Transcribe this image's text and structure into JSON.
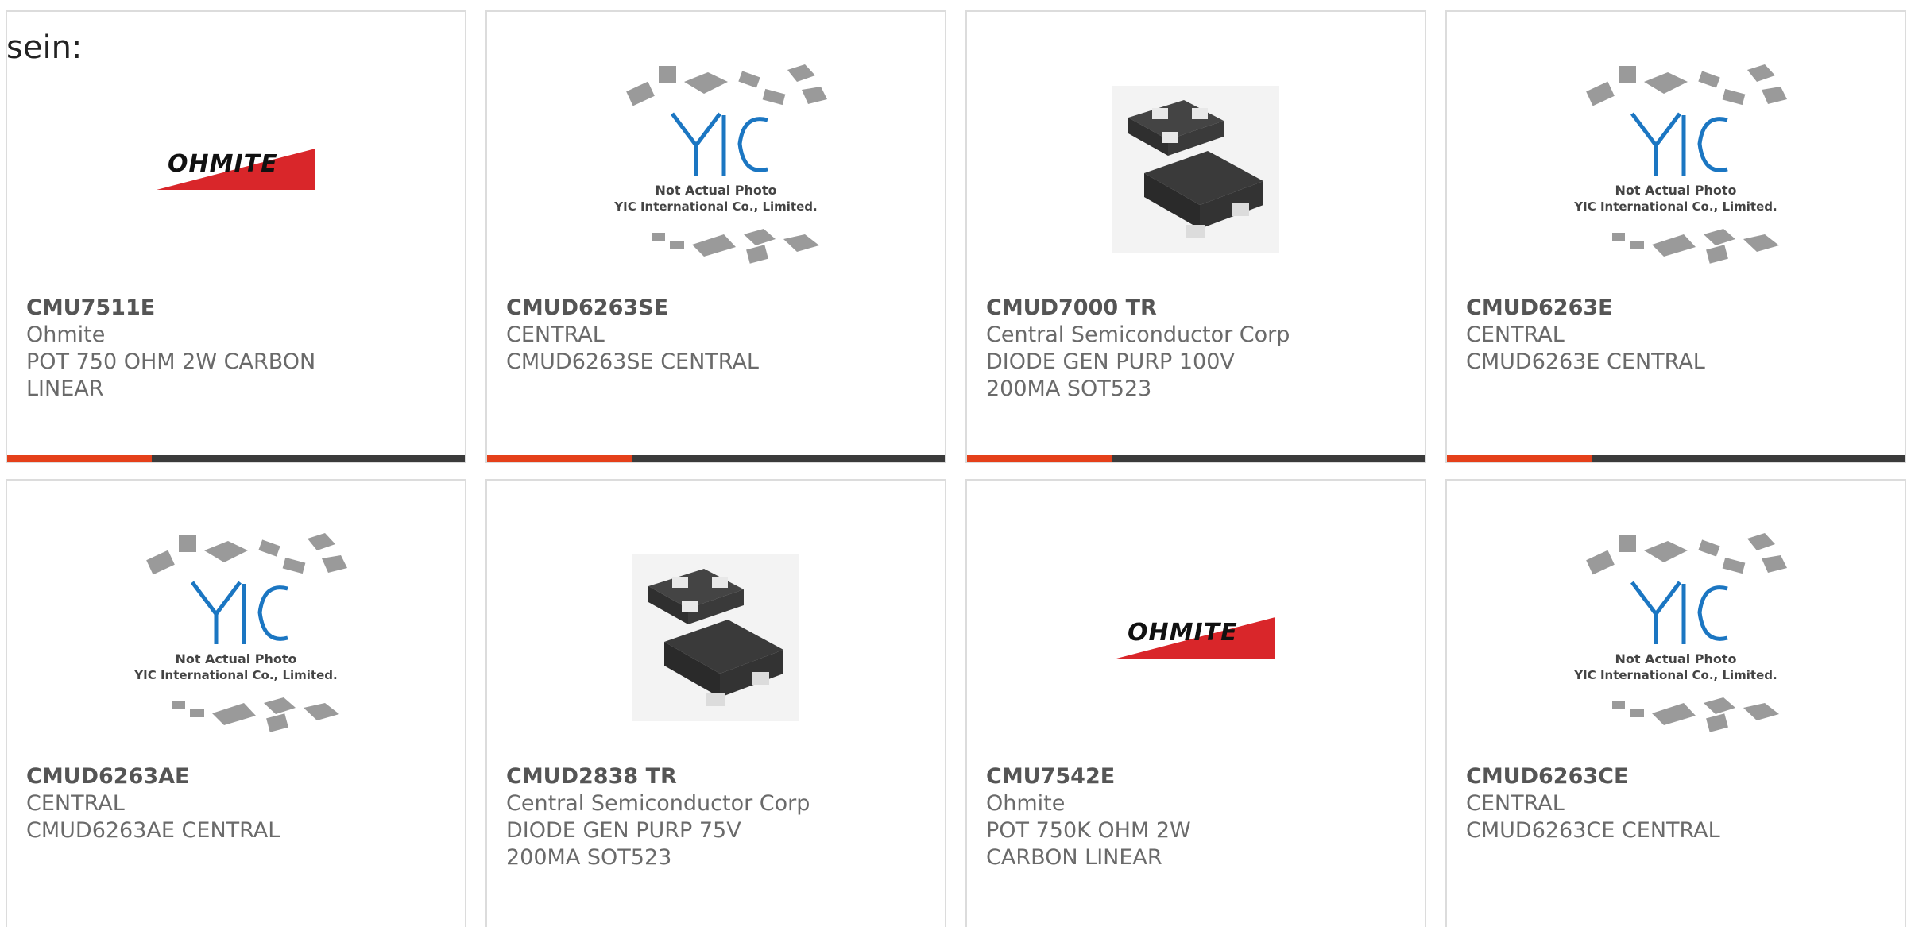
{
  "page": {
    "fragment_text": "sein:"
  },
  "colors": {
    "accent": "#e5401a",
    "bar": "#3b3b3b",
    "card_border": "#dcdcdc",
    "text": "#6a6a6a",
    "yic_blue": "#1b76c2",
    "ohmite_red": "#d9262a"
  },
  "placeholder": {
    "line1": "Not Actual Photo",
    "line2": "YIC International Co., Limited.",
    "logo": "YIC"
  },
  "brand_logo": {
    "ohmite": "OHMITE"
  },
  "products": [
    {
      "part": "CMU7511E",
      "maker": "Ohmite",
      "desc": "POT 750 OHM 2W CARBON LINEAR",
      "image": "ohmite-logo"
    },
    {
      "part": "CMUD6263SE",
      "maker": "CENTRAL",
      "desc": "CMUD6263SE CENTRAL",
      "image": "yic-placeholder"
    },
    {
      "part": "CMUD7000 TR",
      "maker": "Central Semiconductor Corp",
      "desc": "DIODE GEN PURP 100V 200MA SOT523",
      "image": "sot523-package"
    },
    {
      "part": "CMUD6263E",
      "maker": "CENTRAL",
      "desc": "CMUD6263E CENTRAL",
      "image": "yic-placeholder"
    },
    {
      "part": "CMUD6263AE",
      "maker": "CENTRAL",
      "desc": "CMUD6263AE CENTRAL",
      "image": "yic-placeholder"
    },
    {
      "part": "CMUD2838 TR",
      "maker": "Central Semiconductor Corp",
      "desc": "DIODE GEN PURP 75V 200MA SOT523",
      "image": "sot523-package"
    },
    {
      "part": "CMU7542E",
      "maker": "Ohmite",
      "desc": "POT 750K OHM 2W CARBON LINEAR",
      "image": "ohmite-logo"
    },
    {
      "part": "CMUD6263CE",
      "maker": "CENTRAL",
      "desc": "CMUD6263CE CENTRAL",
      "image": "yic-placeholder"
    }
  ]
}
